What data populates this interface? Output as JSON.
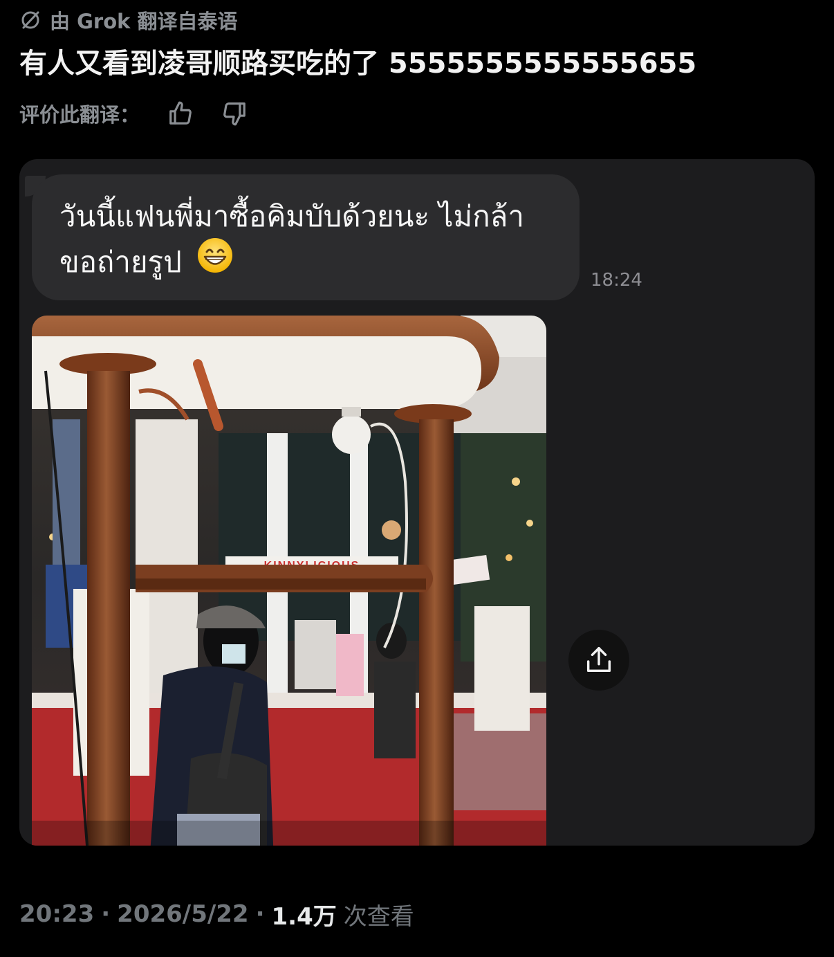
{
  "translation": {
    "header_label": "由 Grok 翻译自泰语",
    "icon": "grok-icon"
  },
  "post": {
    "text": "有人又看到凌哥顺路买吃的了 5555555555555655"
  },
  "rating": {
    "label": "评价此翻译：",
    "thumbs_up_icon": "thumbs-up-icon",
    "thumbs_down_icon": "thumbs-down-icon"
  },
  "card": {
    "message_line1": "วันนี้แฟนพี่มาซื้อคิมบับด้วยนะ ไม่กล้า",
    "message_line2": "ขอถ่ายรูป",
    "emoji_icon": "grinning-face-icon",
    "time": "18:24",
    "photo_sign_text": "KINNYLICIOUS",
    "share_icon": "share-icon"
  },
  "footer": {
    "time": "20:23",
    "date": "2026/5/22",
    "views_count": "1.4万",
    "views_label": "次查看",
    "separator": "·"
  },
  "colors": {
    "background": "#000000",
    "card": "#1c1c1e",
    "bubble": "#2c2c2e",
    "muted_text": "#8b8f94"
  }
}
